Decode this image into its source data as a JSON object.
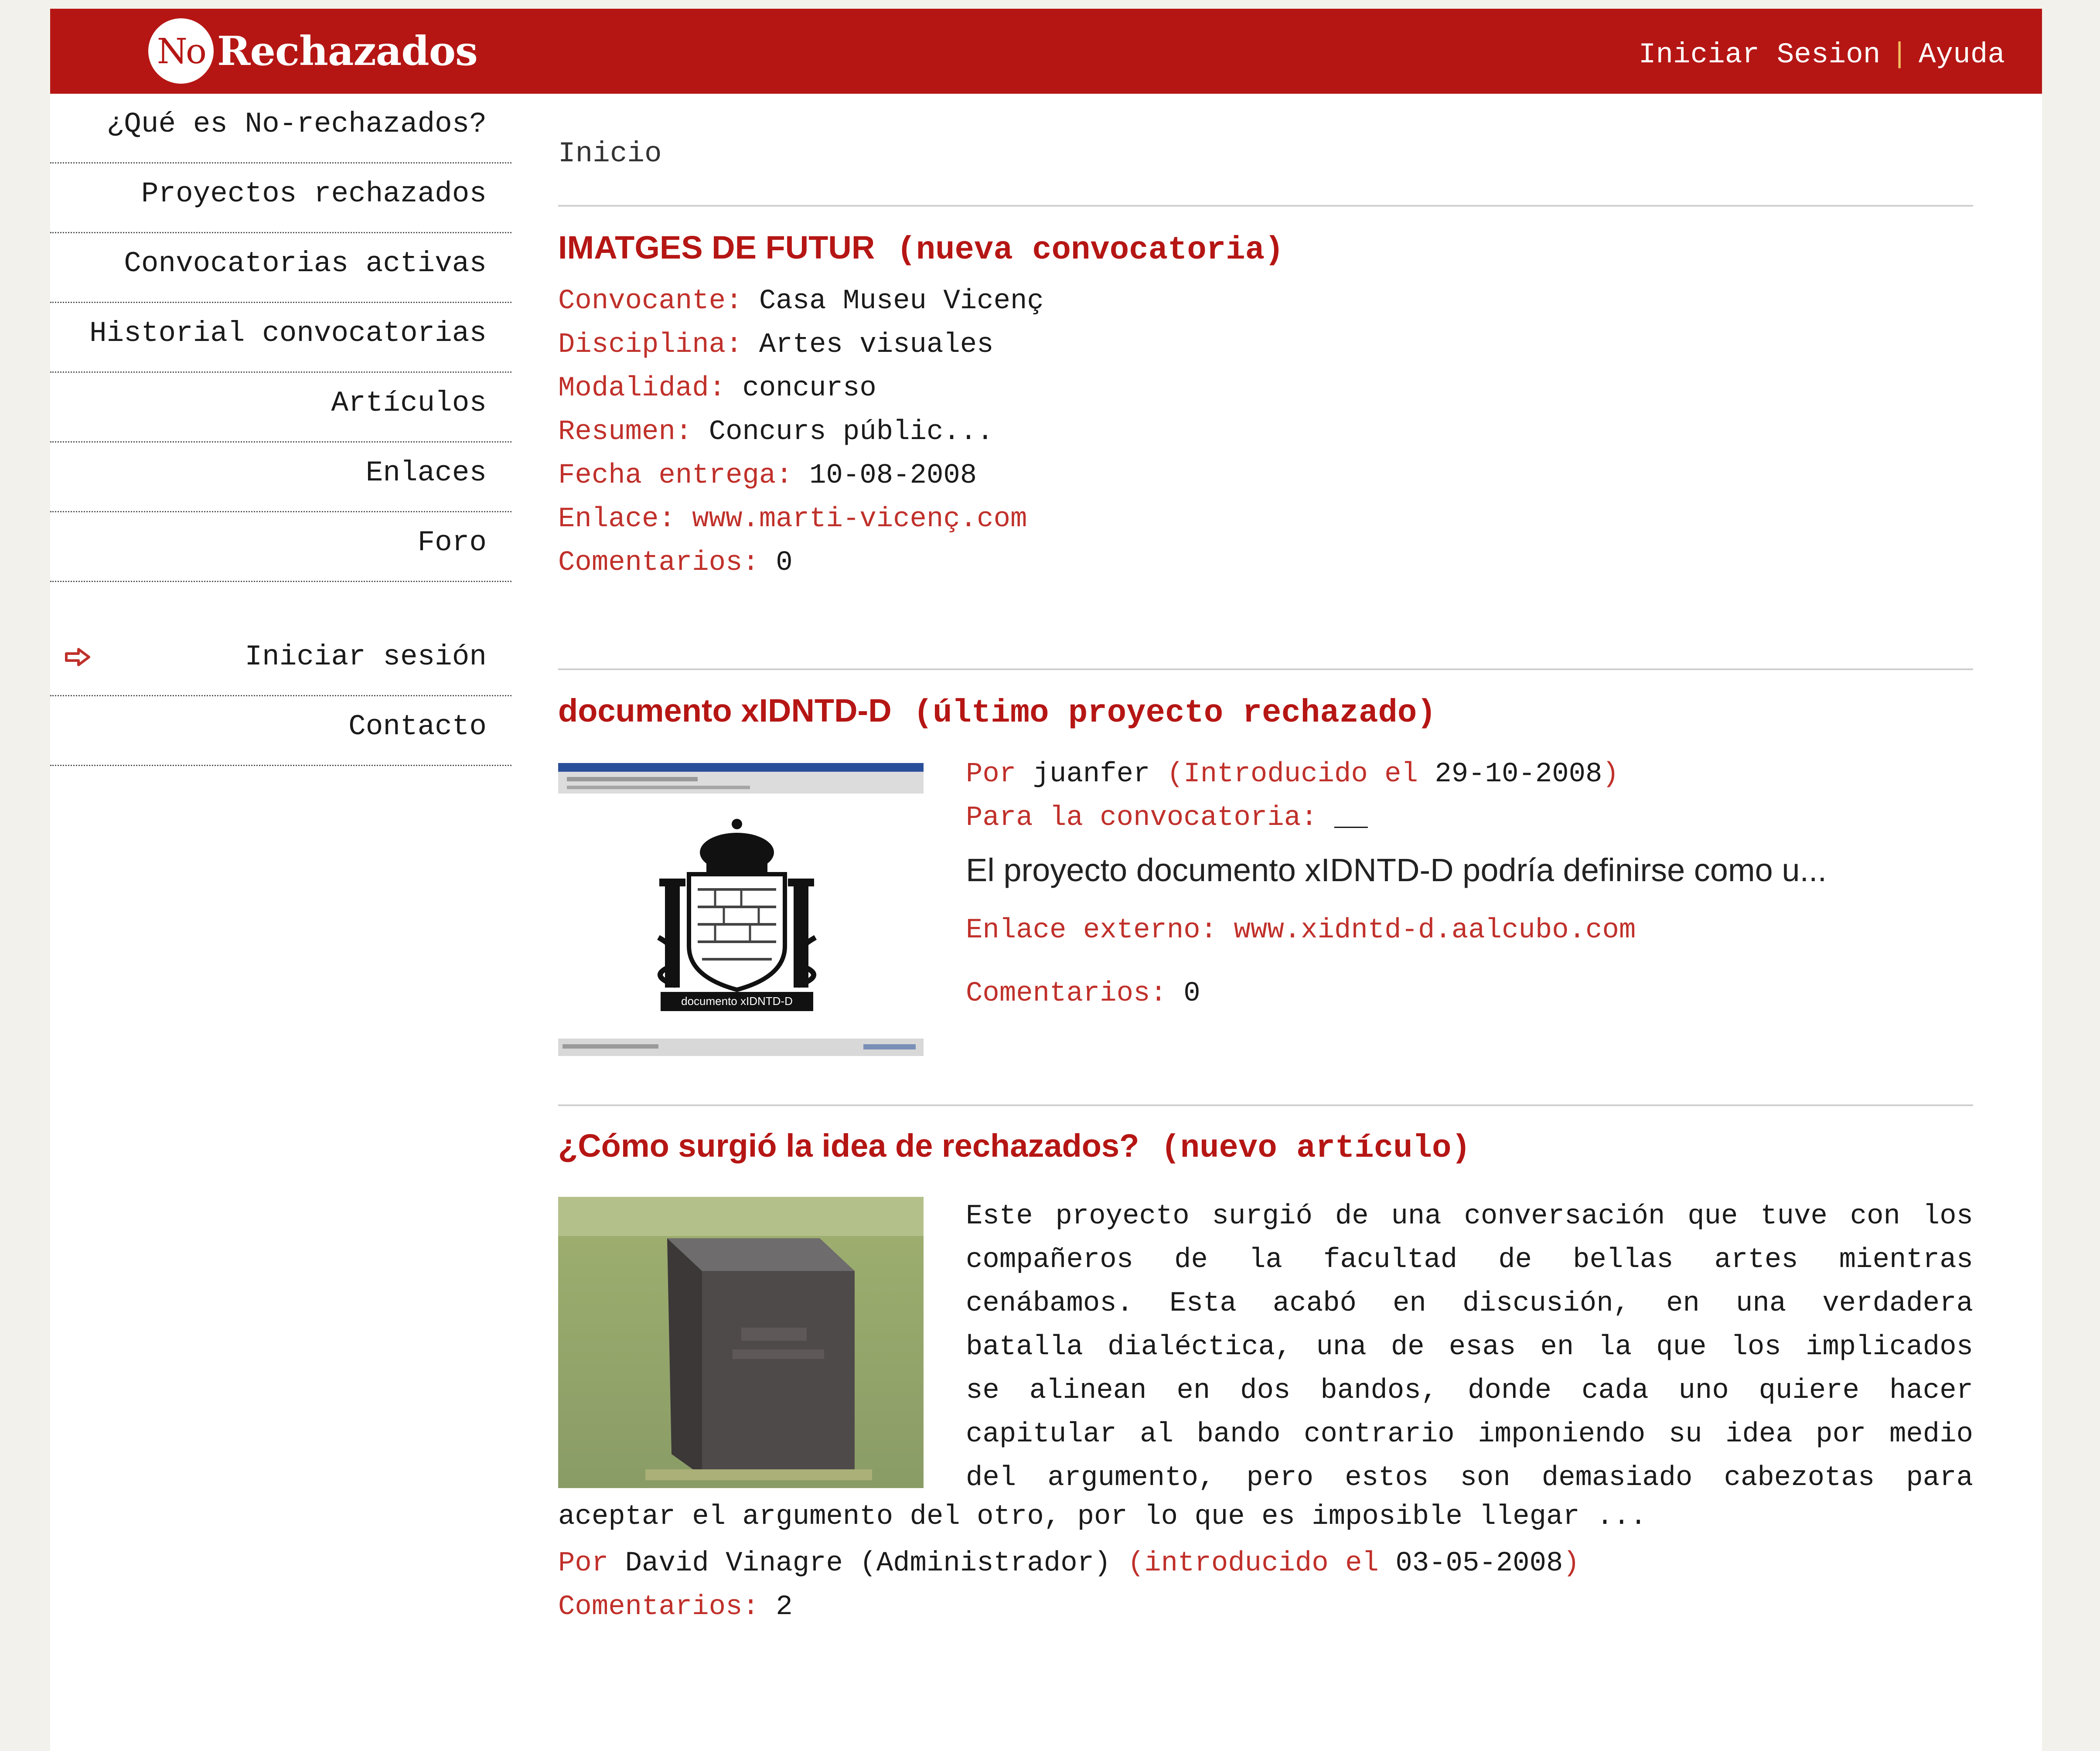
{
  "header": {
    "logo_no": "No",
    "logo_text": "Rechazados",
    "login": "Iniciar Sesion",
    "separator": "|",
    "help": "Ayuda",
    "bg_color": "#b51614"
  },
  "sidebar": {
    "items": [
      {
        "label": "¿Qué es No-rechazados?"
      },
      {
        "label": "Proyectos rechazados"
      },
      {
        "label": "Convocatorias activas"
      },
      {
        "label": "Historial convocatorias"
      },
      {
        "label": "Artículos"
      },
      {
        "label": "Enlaces"
      },
      {
        "label": "Foro"
      }
    ],
    "secondary": [
      {
        "label": "Iniciar sesión",
        "icon": "arrow-right-icon"
      },
      {
        "label": "Contacto"
      }
    ]
  },
  "main": {
    "breadcrumb": "Inicio",
    "call": {
      "title": "IMATGES DE FUTUR",
      "tag": "(nueva convocatoria)",
      "convocante_label": "Convocante:",
      "convocante": "Casa Museu Vicenç",
      "disciplina_label": "Disciplina:",
      "disciplina": "Artes visuales",
      "modalidad_label": "Modalidad:",
      "modalidad": "concurso",
      "resumen_label": "Resumen:",
      "resumen": "Concurs públic...",
      "fecha_label": "Fecha entrega:",
      "fecha": "10-08-2008",
      "enlace_label": "Enlace:",
      "enlace": "www.marti-vicenç.com",
      "comentarios_label": "Comentarios:",
      "comentarios": "0"
    },
    "project": {
      "title": "documento xIDNTD-D",
      "tag": "(último proyecto rechazado)",
      "por_label": "Por",
      "author": "juanfer",
      "intro_open": "(Introducido el",
      "date": "29-10-2008",
      "intro_close": ")",
      "para_label": "Para la convocatoria:",
      "para_value": "__",
      "summary": "El proyecto documento xIDNTD-D podría definirse como u...",
      "enlace_label": "Enlace externo:",
      "enlace": "www.xidntd-d.aalcubo.com",
      "comentarios_label": "Comentarios:",
      "comentarios": "0",
      "thumb_caption": "documento xIDNTD-D"
    },
    "article": {
      "title": "¿Cómo surgió la idea de rechazados?",
      "tag": "(nuevo artículo)",
      "text_lines": [
        "Este proyecto surgió de una conversación que tuve con los",
        "compañeros de la facultad de bellas artes mientras",
        "cenábamos. Esta acabó en discusión, en una verdadera",
        "batalla dialéctica, una de esas en la que los implicados",
        "se alinean en dos bandos, donde cada uno quiere hacer",
        "capitular al bando contrario imponiendo su idea por medio",
        "del argumento, pero estos son demasiado cabezotas para"
      ],
      "text_last": "aceptar el argumento del otro, por lo que es imposible llegar ...",
      "por_label": "Por",
      "author": "David Vinagre (Administrador)",
      "intro_open": "(introducido el",
      "date": "03-05-2008",
      "intro_close": ")",
      "comentarios_label": "Comentarios:",
      "comentarios": "2"
    }
  }
}
